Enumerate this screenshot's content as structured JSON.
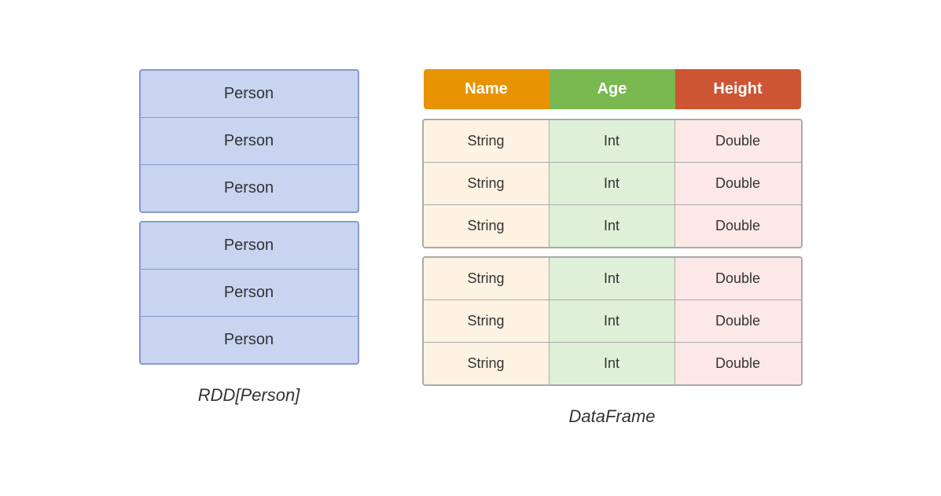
{
  "left": {
    "label": "RDD[Person]",
    "partitions": [
      {
        "rows": [
          "Person",
          "Person",
          "Person"
        ]
      },
      {
        "rows": [
          "Person",
          "Person",
          "Person"
        ]
      }
    ]
  },
  "right": {
    "label": "DataFrame",
    "header": [
      "Name",
      "Age",
      "Height"
    ],
    "partitions": [
      {
        "rows": [
          [
            "String",
            "Int",
            "Double"
          ],
          [
            "String",
            "Int",
            "Double"
          ],
          [
            "String",
            "Int",
            "Double"
          ]
        ]
      },
      {
        "rows": [
          [
            "String",
            "Int",
            "Double"
          ],
          [
            "String",
            "Int",
            "Double"
          ],
          [
            "String",
            "Int",
            "Double"
          ]
        ]
      }
    ]
  }
}
